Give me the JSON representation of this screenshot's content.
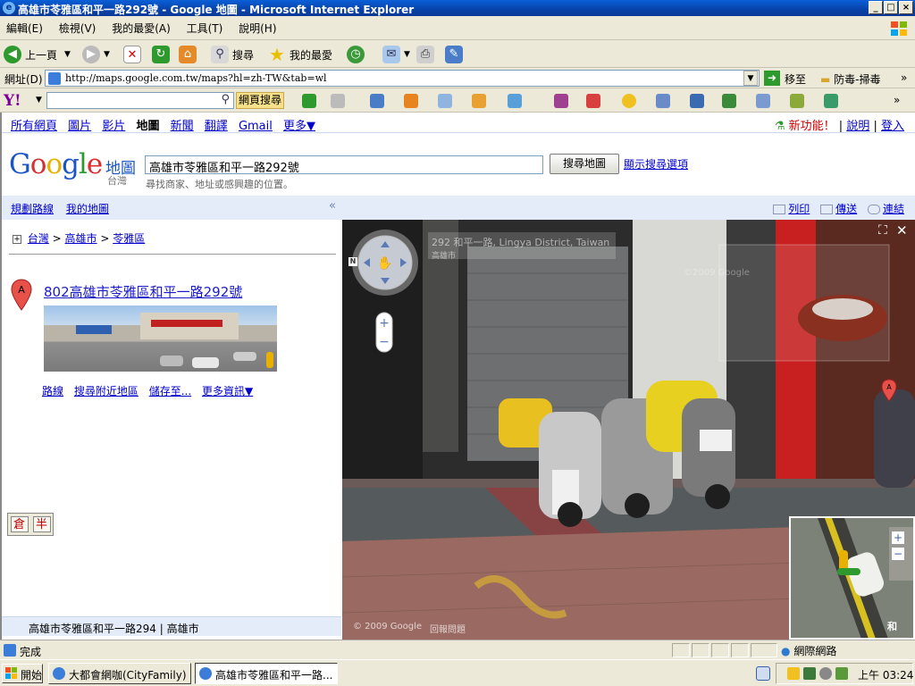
{
  "window": {
    "title": "高雄市苓雅區和平一路292號 - Google 地圖 - Microsoft Internet Explorer",
    "min": "_",
    "max": "□",
    "close": "×"
  },
  "menu": [
    "編輯(E)",
    "檢視(V)",
    "我的最愛(A)",
    "工具(T)",
    "說明(H)"
  ],
  "toolbar": {
    "back": "上一頁",
    "search": "搜尋",
    "favorites": "我的最愛"
  },
  "address": {
    "label": "網址(D)",
    "url": "http://maps.google.com.tw/maps?hl=zh-TW&tab=wl",
    "go": "移至",
    "antivirus": "防毒-掃毒"
  },
  "yahoo": {
    "search_btn": "網頁搜尋"
  },
  "gbar": {
    "links": [
      "所有網頁",
      "圖片",
      "影片"
    ],
    "current": "地圖",
    "links2": [
      "新聞",
      "翻譯",
      "Gmail",
      "更多▼"
    ],
    "newfeature": "新功能！",
    "help": "說明",
    "login": "登入"
  },
  "header": {
    "logo": "Google",
    "maps_word": "地圖",
    "region": "台灣",
    "query": "高雄市苓雅區和平一路292號",
    "search_btn": "搜尋地圖",
    "options": "顯示搜尋選項",
    "hint": "尋找商家、地址或感興趣的位置。"
  },
  "strip": {
    "directions": "規劃路線",
    "mymaps": "我的地圖",
    "collapse": "«",
    "print": "列印",
    "send": "傳送",
    "link": "連結"
  },
  "left": {
    "crumbs": [
      "台灣",
      "高雄市",
      "苓雅區"
    ],
    "result_title": "802高雄市苓雅區和平一路292號",
    "pin": "A",
    "links": [
      "路線",
      "搜尋附近地區",
      "儲存至...",
      "更多資訊▼"
    ],
    "bottom": "高雄市苓雅區和平一路294",
    "bottom_city": "高雄市"
  },
  "ime": [
    "倉",
    "半"
  ],
  "streetview": {
    "addr": "292 和平一路, Lingya District, Taiwan",
    "addr_sub": "高雄市",
    "copyright": "© 2009 Google",
    "report": "回報問題",
    "watermark": "©2009 Google",
    "compass": "N",
    "pin": "A",
    "mm_road": "和"
  },
  "status": {
    "text": "完成",
    "zone": "網際網路"
  },
  "taskbar": {
    "start": "開始",
    "tasks": [
      "大都會網咖(CityFamily) ...",
      "高雄市苓雅區和平一路..."
    ],
    "clock": "上午 03:24"
  }
}
